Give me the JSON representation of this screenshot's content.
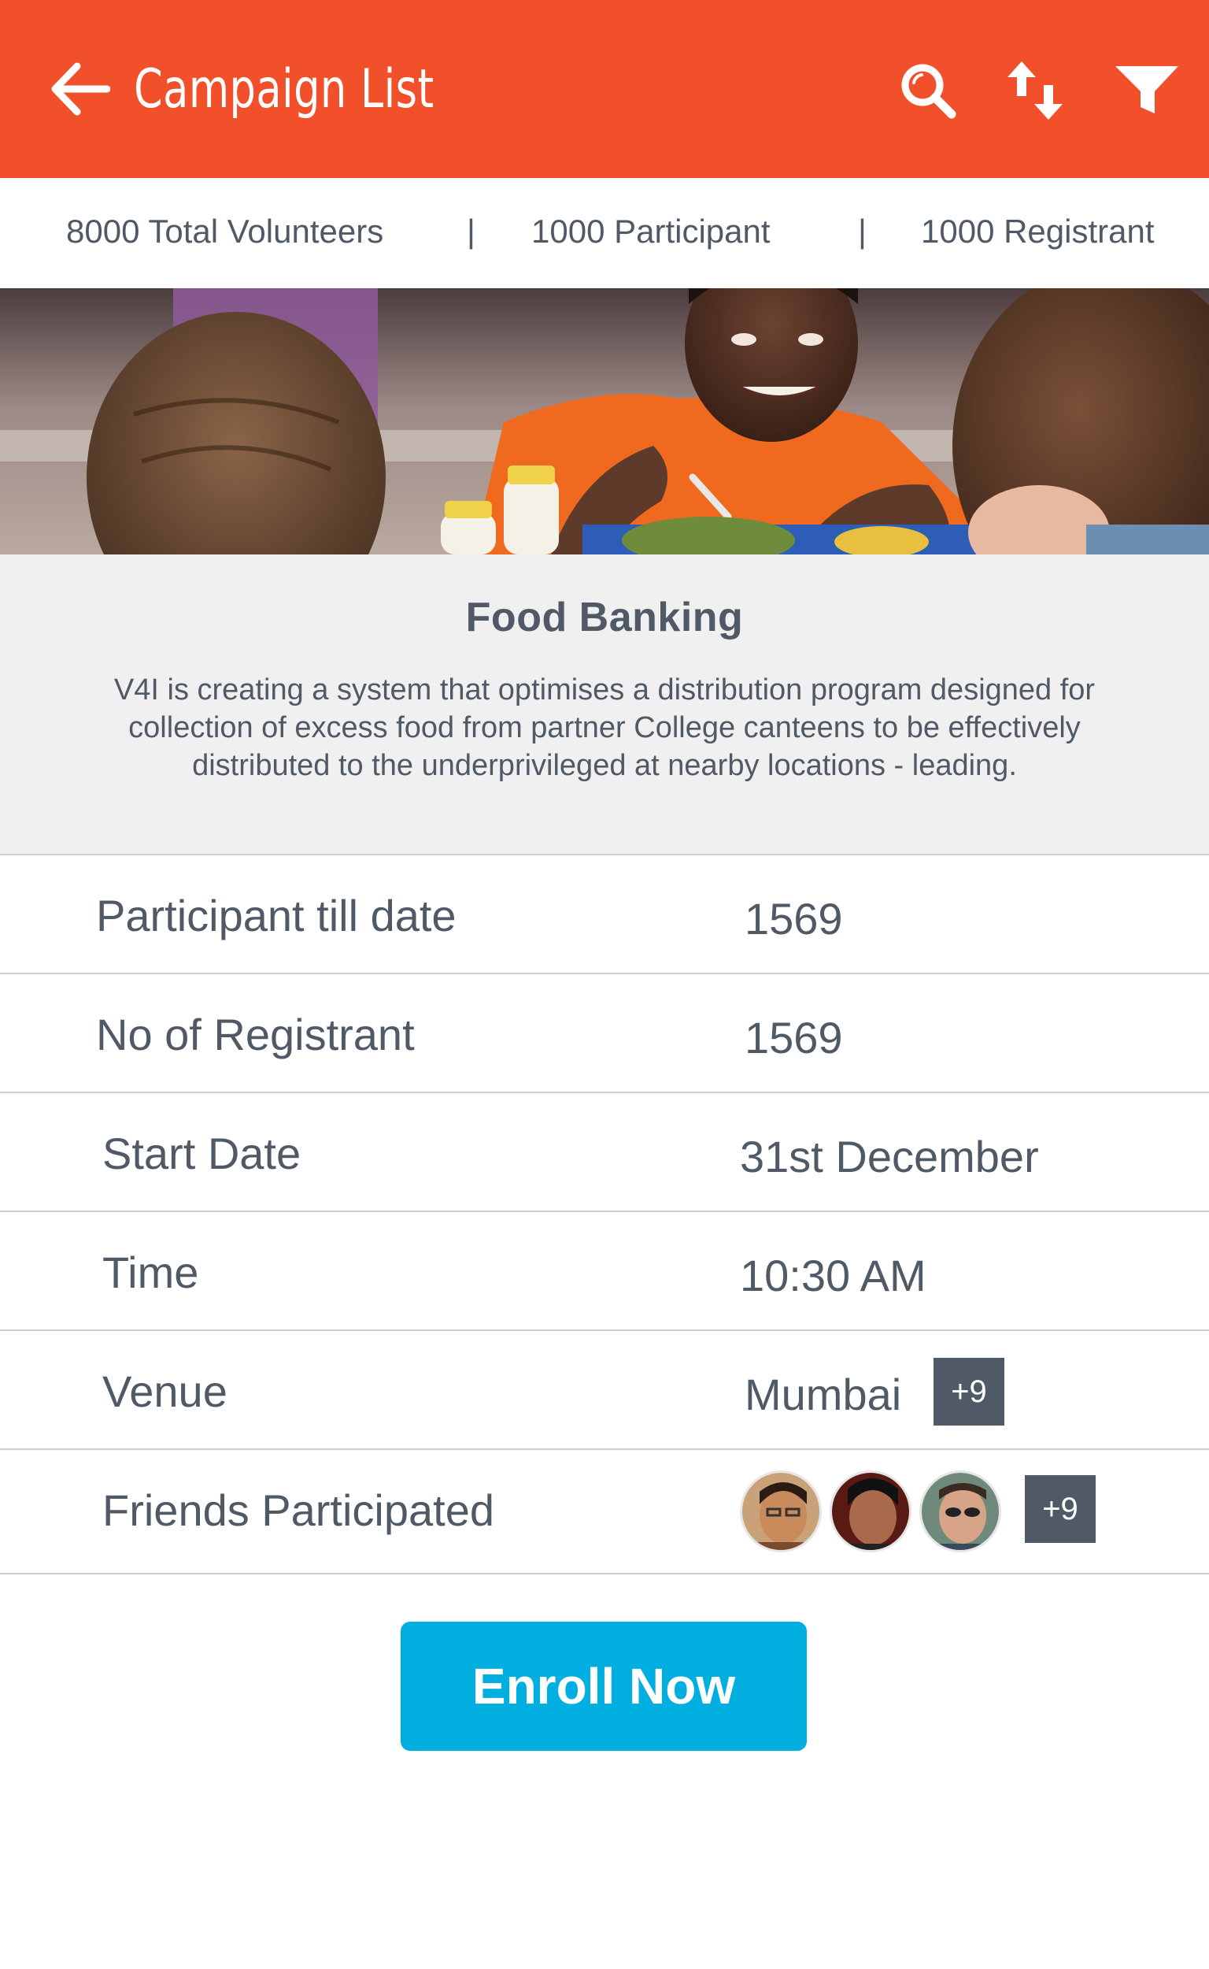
{
  "header": {
    "title": "Campaign List",
    "icons": [
      "back-arrow-icon",
      "search-icon",
      "sort-icon",
      "filter-icon"
    ],
    "background": "#f1502b"
  },
  "stats": {
    "volunteers": "8000 Total Volunteers",
    "separator": "|",
    "participants": "1000 Participant",
    "registrants": "1000 Registrant"
  },
  "campaign": {
    "title": "Food Banking",
    "description": "V4I is creating a system that optimises a distribution program designed for collection of excess food from partner College canteens to be effectively distributed to the underprivileged at nearby locations - leading."
  },
  "details": [
    {
      "label": "Participant till date",
      "value": "1569"
    },
    {
      "label": "No of Registrant",
      "value": "1569"
    },
    {
      "label": "Start Date",
      "value": "31st December"
    },
    {
      "label": "Time",
      "value": "10:30 AM"
    },
    {
      "label": "Venue",
      "value": "Mumbai",
      "badge": "+9"
    },
    {
      "label": "Friends Participated",
      "badge": "+9"
    }
  ],
  "action": {
    "enroll_label": "Enroll Now",
    "color": "#00aee0"
  }
}
